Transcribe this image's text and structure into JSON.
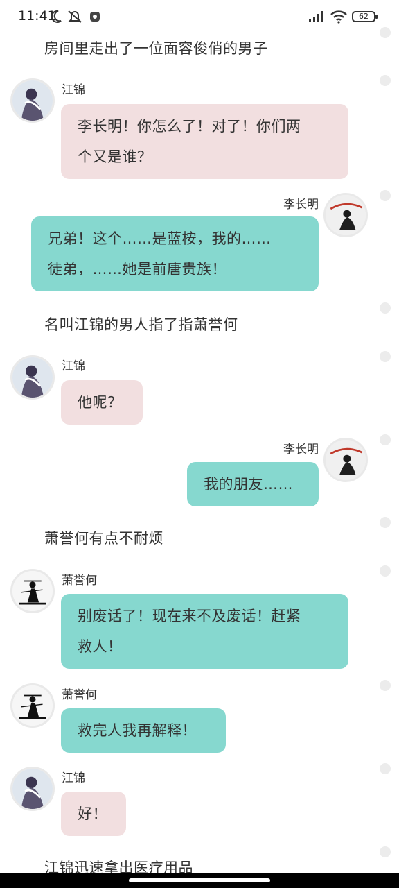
{
  "status_bar": {
    "time": "11:41",
    "battery": "62",
    "icons": [
      "moon-icon",
      "mute-icon",
      "settings-badge-icon",
      "signal-icon",
      "wifi-icon",
      "battery-icon"
    ]
  },
  "messages": {
    "narration_1": "房间里走出了一位面容俊俏的男子",
    "msg1": {
      "speaker": "江锦",
      "lines": [
        "李长明！你怎么了！对了！你们两",
        "个又是谁？"
      ]
    },
    "msg2": {
      "speaker": "李长明",
      "lines": [
        "兄弟！这个……是蓝桉，我的……",
        "徒弟，……她是前唐贵族！"
      ]
    },
    "narration_2": "名叫江锦的男人指了指萧誉何",
    "msg3": {
      "speaker": "江锦",
      "text": "他呢？"
    },
    "msg4": {
      "speaker": "李长明",
      "text": "我的朋友……"
    },
    "narration_3": "萧誉何有点不耐烦",
    "msg5": {
      "speaker": "萧誉何",
      "lines": [
        "别废话了！现在来不及废话！赶紧",
        "救人！"
      ]
    },
    "msg6": {
      "speaker": "萧誉何",
      "text": "救完人我再解释！"
    },
    "msg7": {
      "speaker": "江锦",
      "text": "好！"
    },
    "narration_4": "江锦迅速拿出医疗用品"
  },
  "colors": {
    "pink_bubble": "#f2dfe0",
    "teal_bubble": "#86d8cf",
    "rail_dot": "#ececec"
  }
}
